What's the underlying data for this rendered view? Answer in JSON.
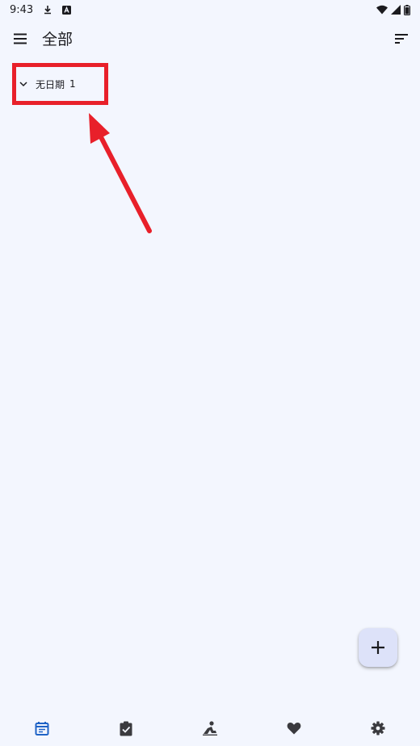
{
  "status_bar": {
    "time": "9:43",
    "icons": [
      "download-icon",
      "notification-a-icon",
      "wifi-icon",
      "signal-icon",
      "battery-icon"
    ]
  },
  "app_bar": {
    "title": "全部",
    "menu_icon": "hamburger-menu-icon",
    "sort_icon": "sort-icon"
  },
  "group": {
    "label": "无日期",
    "count": "1",
    "icon": "chevron-down-icon"
  },
  "annotation": {
    "color": "#e8202a"
  },
  "fab": {
    "icon": "plus-icon"
  },
  "bottom_nav": {
    "items": [
      {
        "icon": "calendar-icon",
        "active": true
      },
      {
        "icon": "checklist-icon",
        "active": false
      },
      {
        "icon": "habit-icon",
        "active": false
      },
      {
        "icon": "heart-icon",
        "active": false
      },
      {
        "icon": "settings-icon",
        "active": false
      }
    ]
  },
  "colors": {
    "background": "#f3f6fe",
    "accent": "#1f63c6",
    "fab_bg": "#dde2f9",
    "text": "#1b1b1f"
  }
}
